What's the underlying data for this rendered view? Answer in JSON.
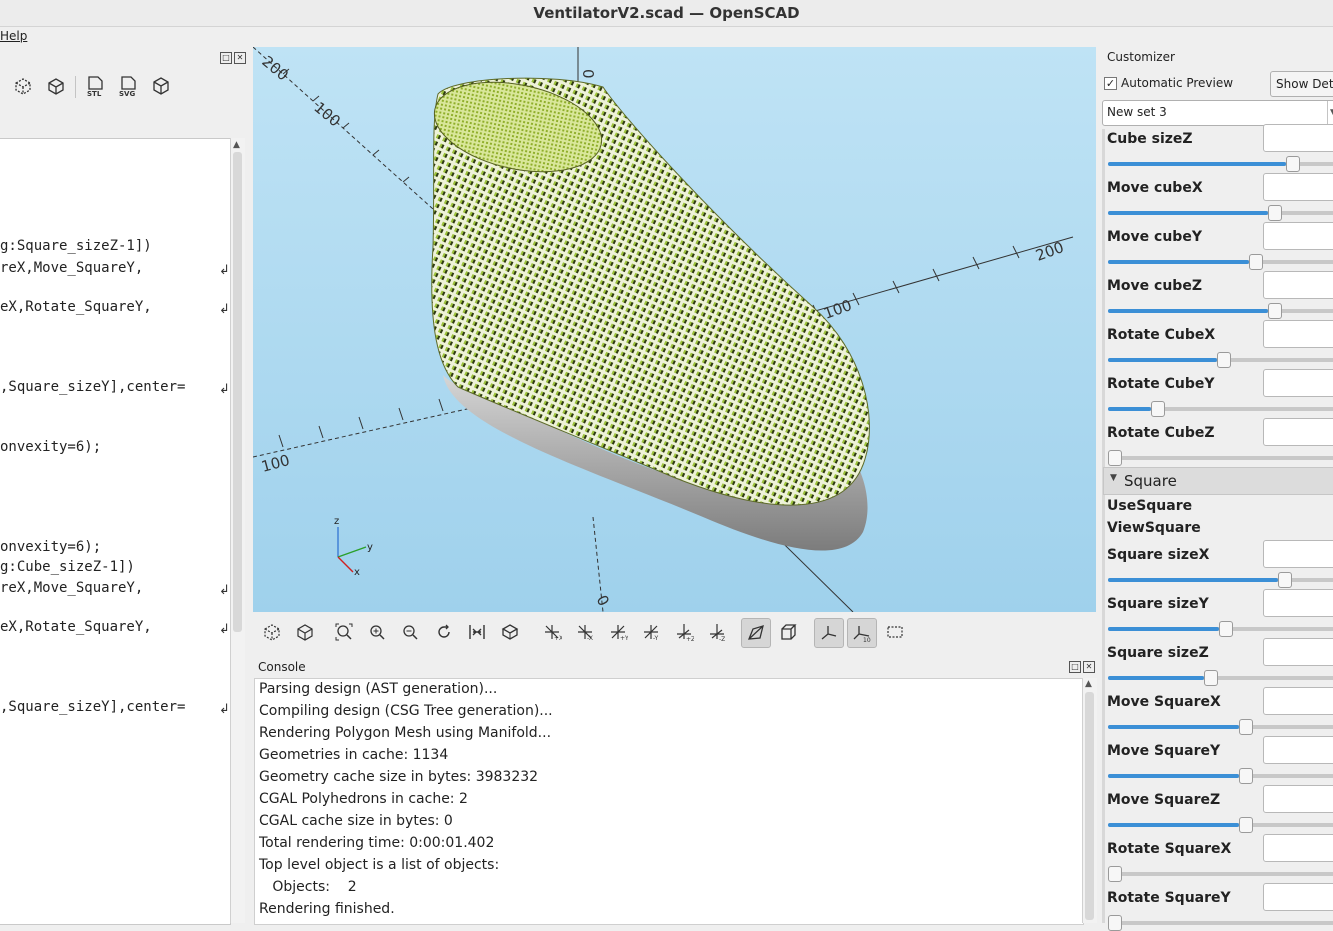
{
  "window": {
    "title": "VentilatorV2.scad — OpenSCAD"
  },
  "menubar": {
    "help": "Help"
  },
  "editor": {
    "lines": [
      {
        "text": "g:Square_sizeZ-1])",
        "wrap": false
      },
      {
        "text": "reX,Move_SquareY,",
        "wrap": true
      },
      {
        "text": "eX,Rotate_SquareY,",
        "wrap": true
      },
      {
        "text": ",Square_sizeY],center=",
        "wrap": true
      },
      {
        "text": "onvexity=6);",
        "wrap": false
      },
      {
        "text": "onvexity=6);",
        "wrap": false
      },
      {
        "text": "g:Cube_sizeZ-1])",
        "wrap": false
      },
      {
        "text": "reX,Move_SquareY,",
        "wrap": true
      },
      {
        "text": "eX,Rotate_SquareY,",
        "wrap": true
      },
      {
        "text": ",Square_sizeY],center=",
        "wrap": true
      }
    ]
  },
  "viewport": {
    "axis_labels": [
      "200",
      "100",
      "0",
      "200",
      "100",
      "100",
      "0"
    ],
    "gizmo": {
      "z": "z",
      "y": "y",
      "x": "x"
    },
    "colors": {
      "background_top": "#bfe3f5",
      "background_bottom": "#9fd1ec",
      "model": "#a9c24a",
      "model_base": "#bdbdbd"
    }
  },
  "view_toolbar": {
    "items": [
      "preview",
      "render",
      "view-all",
      "zoom-in",
      "zoom-out",
      "reset-view",
      "view-center",
      "rotate",
      "right",
      "left",
      "back",
      "front",
      "top",
      "bottom",
      "perspective",
      "orthogonal",
      "show-axes",
      "show-scale-markers",
      "show-edges"
    ]
  },
  "console": {
    "label": "Console",
    "lines": [
      "Parsing design (AST generation)...",
      "Compiling design (CSG Tree generation)...",
      "Rendering Polygon Mesh using Manifold...",
      "Geometries in cache: 1134",
      "Geometry cache size in bytes: 3983232",
      "CGAL Polyhedrons in cache: 2",
      "CGAL cache size in bytes: 0",
      "Total rendering time: 0:00:01.402",
      "Top level object is a list of objects:",
      "   Objects:    2",
      "Rendering finished."
    ]
  },
  "customizer": {
    "title": "Customizer",
    "auto_preview_label": "Automatic Preview",
    "auto_preview_checked": true,
    "show_details_label": "Show Deta",
    "preset": "New set 3",
    "section_square": "Square",
    "use_square": "UseSquare",
    "view_square": "ViewSquare",
    "params": [
      {
        "label": "Cube sizeZ",
        "fraction": 0.87
      },
      {
        "label": "Move cubeX",
        "fraction": 0.78
      },
      {
        "label": "Move cubeY",
        "fraction": 0.69
      },
      {
        "label": "Move cubeZ",
        "fraction": 0.78
      },
      {
        "label": "Rotate CubeX",
        "fraction": 0.53
      },
      {
        "label": "Rotate CubeY",
        "fraction": 0.21
      },
      {
        "label": "Rotate CubeZ",
        "fraction": 0.0
      },
      {
        "label": "Square sizeX",
        "fraction": 0.83
      },
      {
        "label": "Square sizeY",
        "fraction": 0.54
      },
      {
        "label": "Square sizeZ",
        "fraction": 0.47
      },
      {
        "label": "Move SquareX",
        "fraction": 0.64
      },
      {
        "label": "Move SquareY",
        "fraction": 0.64
      },
      {
        "label": "Move SquareZ",
        "fraction": 0.64
      },
      {
        "label": "Rotate SquareX",
        "fraction": 0.0
      },
      {
        "label": "Rotate SquareY",
        "fraction": 0.0
      }
    ]
  }
}
